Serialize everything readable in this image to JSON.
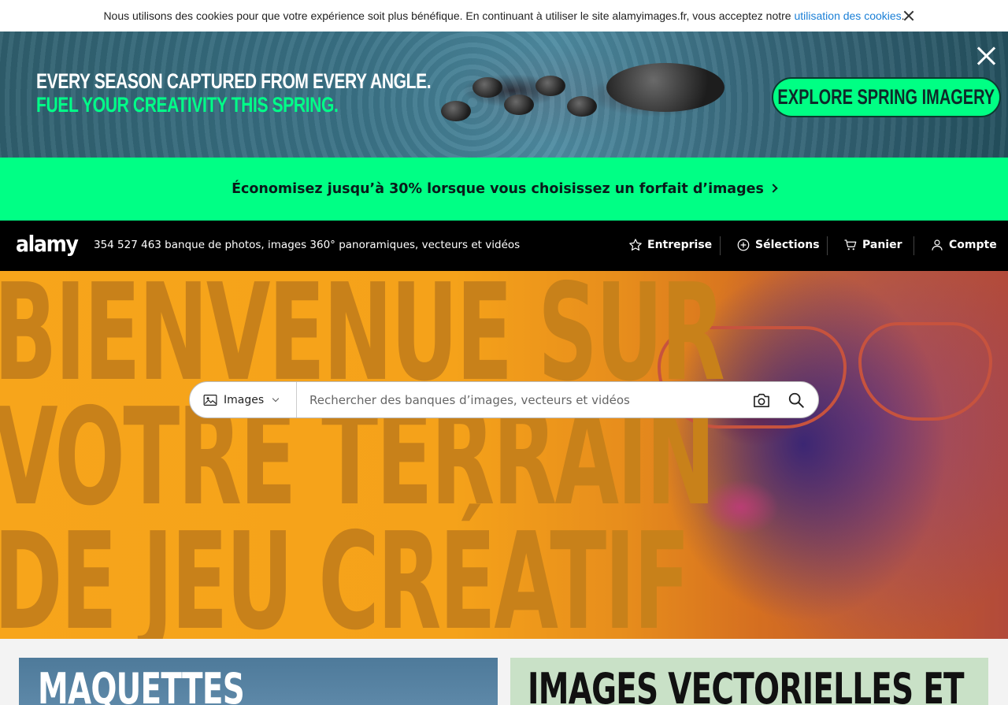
{
  "cookie_bar": {
    "text": "Nous utilisons des cookies pour que votre expérience soit plus bénéfique. En continuant à utiliser le site alamyimages.fr, vous acceptez notre ",
    "link": "utilisation des cookies",
    "suffix": "."
  },
  "ad_banner": {
    "headline_line1": "EVERY SEASON CAPTURED FROM EVERY ANGLE.",
    "headline_line2": "FUEL YOUR CREATIVITY THIS SPRING.",
    "cta": "EXPLORE SPRING IMAGERY",
    "accent_color": "#00ff84"
  },
  "promo": {
    "text": "Économisez jusqu’à 30% lorsque vous choisissez un forfait d’images"
  },
  "header": {
    "logo": "alamy",
    "tagline": "354 527 463 banque de photos, images 360° panoramiques, vecteurs et vidéos",
    "nav": {
      "entreprise": "Entreprise",
      "selections": "Sélections",
      "panier": "Panier",
      "compte": "Compte"
    }
  },
  "hero": {
    "line1": "BIENVENUE SUR",
    "line2": "VOTRE TERRAIN",
    "line3": "DE JEU CRÉATIF"
  },
  "search": {
    "type_label": "Images",
    "placeholder": "Rechercher des banques d’images, vecteurs et vidéos"
  },
  "cards": {
    "left_title": "MAQUETTES",
    "right_title": "IMAGES VECTORIELLES ET"
  }
}
